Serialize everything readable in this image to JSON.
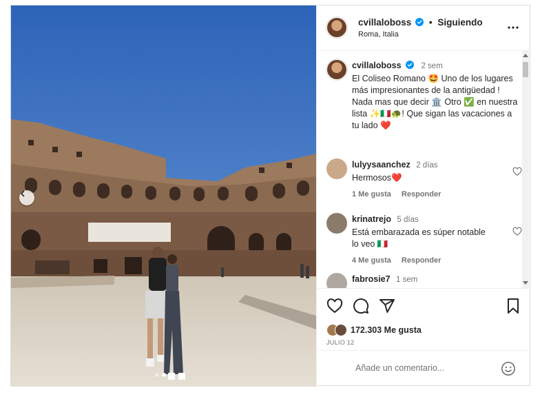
{
  "post": {
    "username": "cvillaloboss",
    "follow_status": "Siguiendo",
    "location": "Roma, Italia",
    "caption_time": "2 sem",
    "caption_text": "El Coliseo Romano 🤩 Uno de los lugares más impresionantes de la antigüedad ! Nada mas que decir 🏛️ Otro ✅ en nuestra lista ✨🇮🇹🐢! Que sigan las vacaciones a tu lado ❤️",
    "likes": "172.303 Me gusta",
    "date": "JULIO 12",
    "carousel": {
      "slides": 3,
      "active_index": 1
    }
  },
  "comments": [
    {
      "user": "lulyysaanchez",
      "time": "2 días",
      "text": "Hermosos❤️",
      "likes": "1 Me gusta",
      "reply": "Responder",
      "avatar_color": "#c9a98a"
    },
    {
      "user": "krinatrejo",
      "time": "5 días",
      "text": "Está embarazada es súper notable lo veo 🇮🇹",
      "likes": "4 Me gusta",
      "reply": "Responder",
      "avatar_color": "#8b7b6b"
    },
    {
      "user": "fabrosie7",
      "time": "1 sem",
      "text": "",
      "likes": "",
      "reply": "",
      "avatar_color": "#b0a7a0"
    }
  ],
  "composer": {
    "placeholder": "Añade un comentario..."
  },
  "icons": {
    "more": "more-options-icon",
    "like": "heart-icon",
    "comment": "comment-icon",
    "share": "send-icon",
    "save": "bookmark-icon",
    "emoji": "emoji-icon",
    "verified": "verified-badge-icon",
    "prev": "chevron-left-icon"
  },
  "colors": {
    "verified": "#0095f6",
    "text": "#262626",
    "muted": "#737373",
    "border": "#dbdbdb"
  }
}
